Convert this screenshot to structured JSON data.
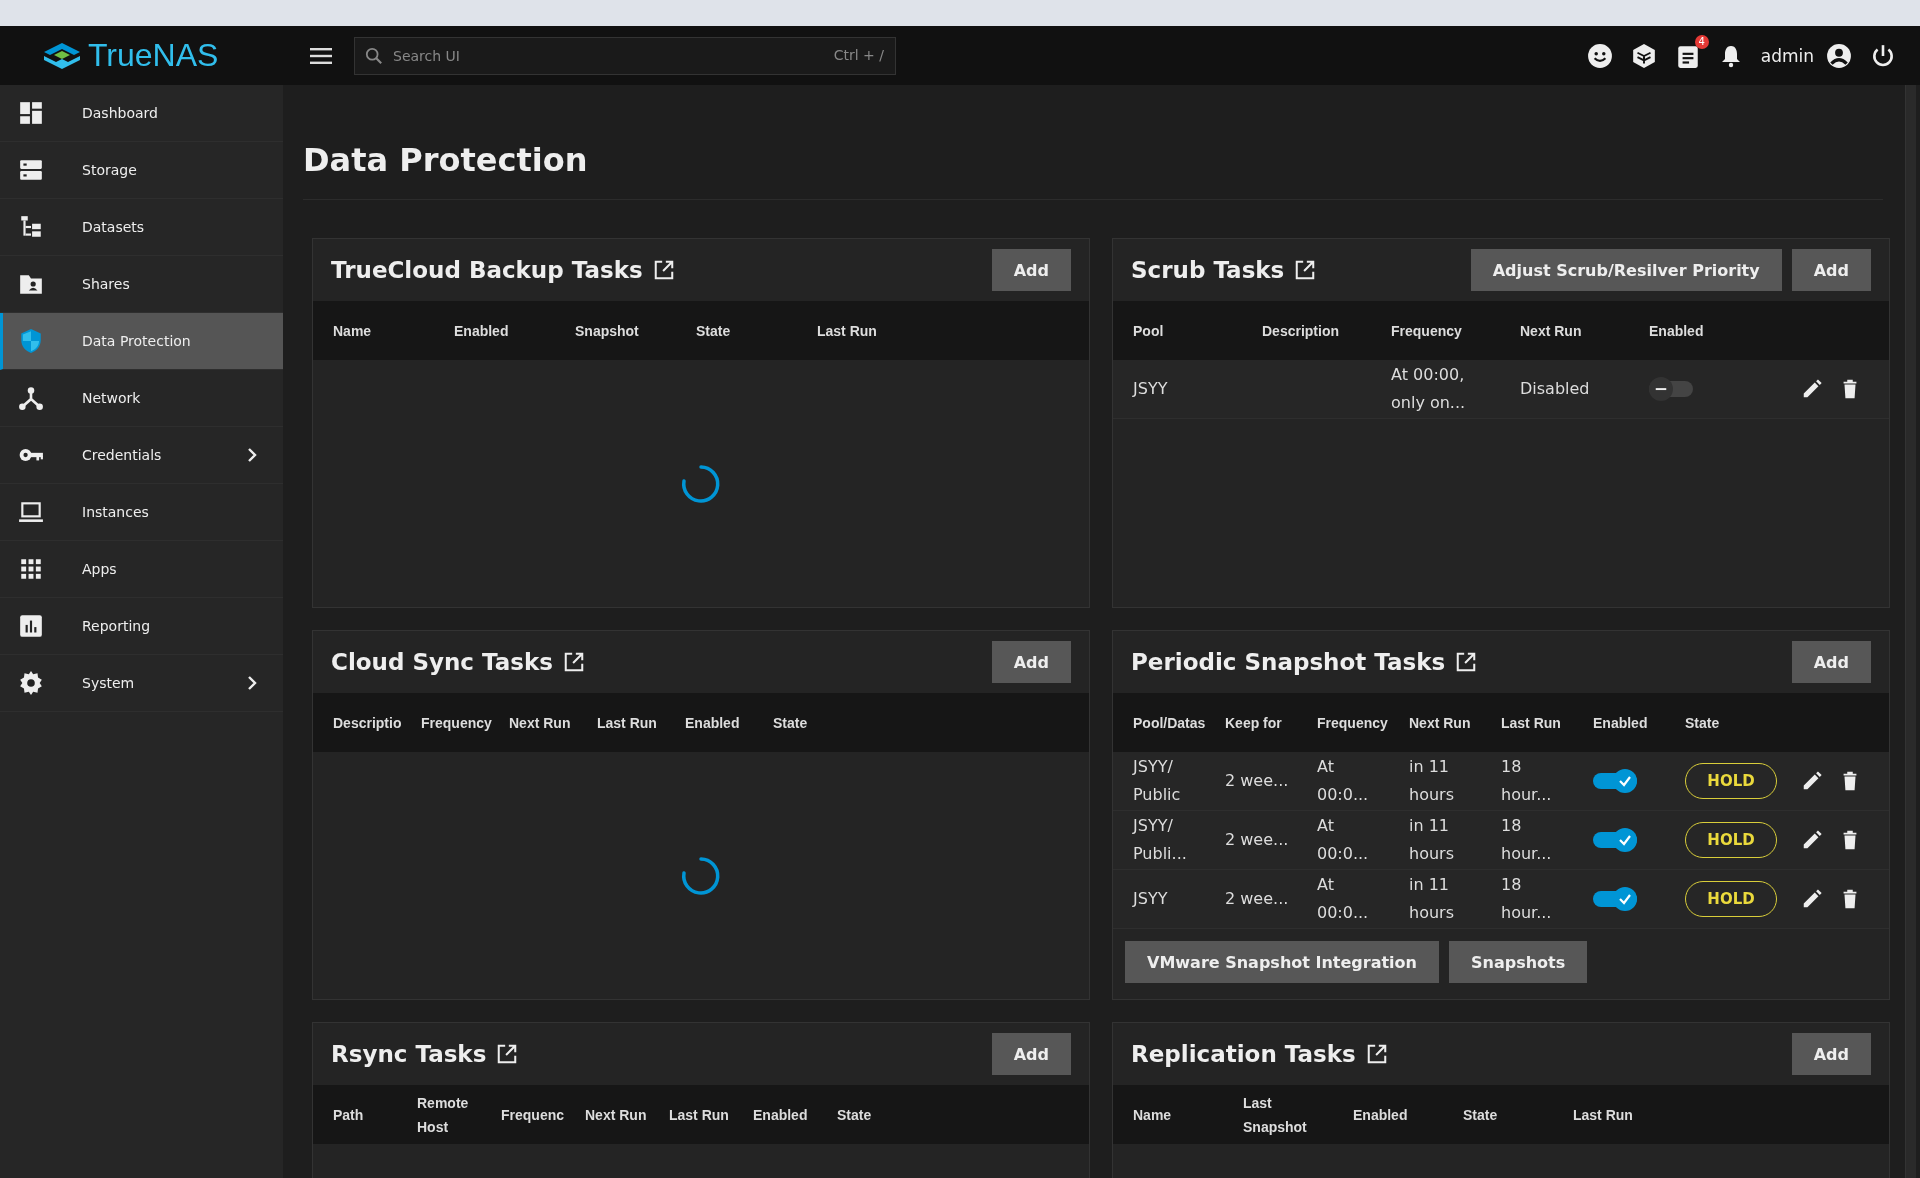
{
  "topbar": {
    "logo": "TrueNAS",
    "search": {
      "placeholder": "Search UI",
      "shortcut": "Ctrl + /"
    },
    "notification_count": "4",
    "user": "admin"
  },
  "sidebar": {
    "items": [
      {
        "label": "Dashboard",
        "selected": false,
        "expandable": false
      },
      {
        "label": "Storage",
        "selected": false,
        "expandable": false
      },
      {
        "label": "Datasets",
        "selected": false,
        "expandable": false
      },
      {
        "label": "Shares",
        "selected": false,
        "expandable": false
      },
      {
        "label": "Data Protection",
        "selected": true,
        "expandable": false
      },
      {
        "label": "Network",
        "selected": false,
        "expandable": false
      },
      {
        "label": "Credentials",
        "selected": false,
        "expandable": true
      },
      {
        "label": "Instances",
        "selected": false,
        "expandable": false
      },
      {
        "label": "Apps",
        "selected": false,
        "expandable": false
      },
      {
        "label": "Reporting",
        "selected": false,
        "expandable": false
      },
      {
        "label": "System",
        "selected": false,
        "expandable": true
      }
    ]
  },
  "page_title": "Data Protection",
  "cards": [
    {
      "title": "TrueCloud Backup Tasks",
      "buttons": [
        "Add"
      ],
      "columns": [
        "Name",
        "Enabled",
        "Snapshot",
        "State",
        "Last Run"
      ],
      "loading": true
    },
    {
      "title": "Scrub Tasks",
      "buttons": [
        "Adjust Scrub/Resilver Priority",
        "Add"
      ],
      "columns": [
        "Pool",
        "Description",
        "Frequency",
        "Next Run",
        "Enabled"
      ],
      "loading": false,
      "rows": [
        [
          {
            "kind": "text",
            "text": "JSYY"
          },
          {
            "kind": "blank"
          },
          {
            "kind": "text",
            "text": "At 00:00, only on..."
          },
          {
            "kind": "text",
            "text": "Disabled"
          },
          {
            "kind": "toggle",
            "on": false
          },
          {
            "kind": "actions"
          }
        ]
      ]
    },
    {
      "title": "Cloud Sync Tasks",
      "buttons": [
        "Add"
      ],
      "columns": [
        "Descriptio",
        "Frequency",
        "Next Run",
        "Last Run",
        "Enabled",
        "State"
      ],
      "loading": true
    },
    {
      "title": "Periodic Snapshot Tasks",
      "buttons": [
        "Add"
      ],
      "columns": [
        "Pool/Datas",
        "Keep for",
        "Frequency",
        "Next Run",
        "Last Run",
        "Enabled",
        "State"
      ],
      "loading": false,
      "rows": [
        [
          {
            "kind": "text",
            "text": "JSYY/ Public"
          },
          {
            "kind": "text",
            "text": "2 wee..."
          },
          {
            "kind": "text",
            "text": "At 00:0..."
          },
          {
            "kind": "text",
            "text": "in 11 hours"
          },
          {
            "kind": "text",
            "text": "18 hour..."
          },
          {
            "kind": "toggle",
            "on": true
          },
          {
            "kind": "badge",
            "text": "HOLD"
          },
          {
            "kind": "actions"
          }
        ],
        [
          {
            "kind": "text",
            "text": "JSYY/ Publi..."
          },
          {
            "kind": "text",
            "text": "2 wee..."
          },
          {
            "kind": "text",
            "text": "At 00:0..."
          },
          {
            "kind": "text",
            "text": "in 11 hours"
          },
          {
            "kind": "text",
            "text": "18 hour..."
          },
          {
            "kind": "toggle",
            "on": true
          },
          {
            "kind": "badge",
            "text": "HOLD"
          },
          {
            "kind": "actions"
          }
        ],
        [
          {
            "kind": "text",
            "text": "JSYY"
          },
          {
            "kind": "text",
            "text": "2 wee..."
          },
          {
            "kind": "text",
            "text": "At 00:0..."
          },
          {
            "kind": "text",
            "text": "in 11 hours"
          },
          {
            "kind": "text",
            "text": "18 hour..."
          },
          {
            "kind": "toggle",
            "on": true
          },
          {
            "kind": "badge",
            "text": "HOLD"
          },
          {
            "kind": "actions"
          }
        ]
      ],
      "footer_buttons": [
        "VMware Snapshot Integration",
        "Snapshots"
      ]
    },
    {
      "title": "Rsync Tasks",
      "buttons": [
        "Add"
      ],
      "columns": [
        "Path",
        "Remote Host",
        "Frequenc",
        "Next Run",
        "Last Run",
        "Enabled",
        "State"
      ]
    },
    {
      "title": "Replication Tasks",
      "buttons": [
        "Add"
      ],
      "columns": [
        "Name",
        "Last Snapshot",
        "Enabled",
        "State",
        "Last Run"
      ]
    }
  ]
}
